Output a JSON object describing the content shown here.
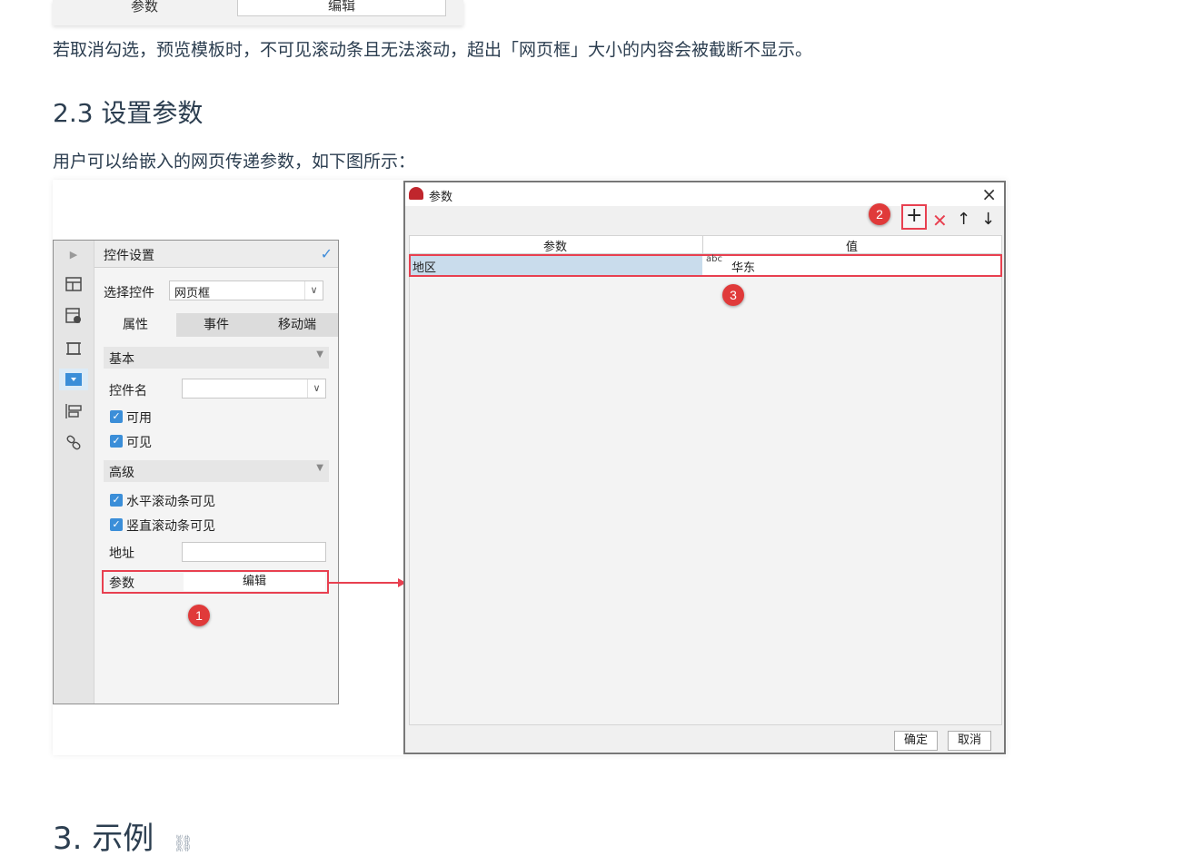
{
  "top_fragment": {
    "label": "参数",
    "button": "编辑"
  },
  "para1": "若取消勾选，预览模板时，不可见滚动条且无法滚动，超出「网页框」大小的内容会被截断不显示。",
  "section_2_3": "2.3 设置参数",
  "para2": "用户可以给嵌入的网页传递参数，如下图所示：",
  "left_panel": {
    "title": "控件设置",
    "select_label": "选择控件",
    "select_value": "网页框",
    "tabs": [
      "属性",
      "事件",
      "移动端"
    ],
    "basic_section": "基本",
    "name_label": "控件名",
    "enabled": "可用",
    "visible": "可见",
    "advanced_section": "高级",
    "h_scroll": "水平滚动条可见",
    "v_scroll": "竖直滚动条可见",
    "address_label": "地址",
    "param_label": "参数",
    "param_button": "编辑",
    "sidebar_icons": [
      "expand-icon",
      "layout-icon",
      "widget-info-icon",
      "frame-icon",
      "widget-icon",
      "form-icon",
      "link-icon"
    ]
  },
  "dialog": {
    "title": "参数",
    "col_param": "参数",
    "col_value": "值",
    "row_param": "地区",
    "row_type": "abc",
    "row_value": "华东",
    "ok": "确定",
    "cancel": "取消"
  },
  "badges": [
    "1",
    "2",
    "3"
  ],
  "section_3": "3. 示例",
  "colors": {
    "accent_red": "#e84050",
    "checkbox_blue": "#3b8ed8",
    "text": "#2c3e50"
  }
}
